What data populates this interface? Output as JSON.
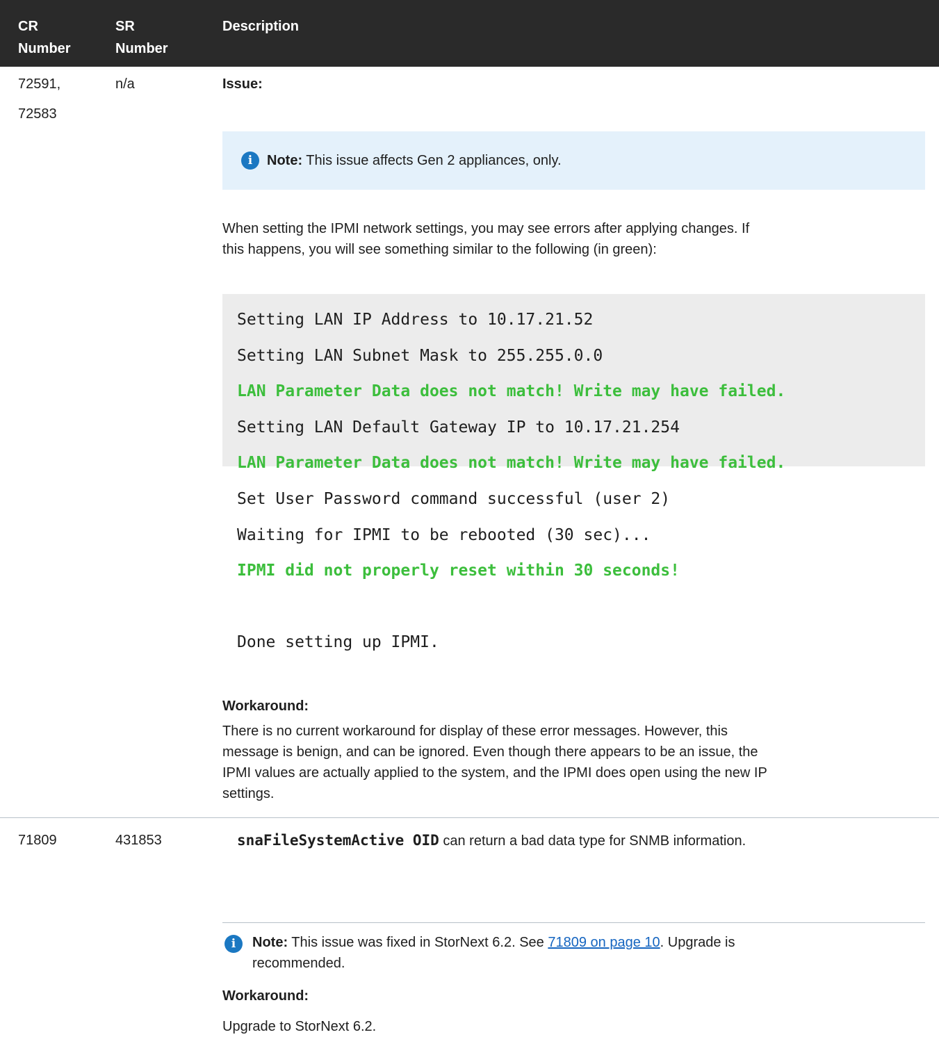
{
  "header": {
    "cr_line1": "CR",
    "cr_line2": "Number",
    "sr_line1": "SR",
    "sr_line2": "Number",
    "description": "Description"
  },
  "row1": {
    "cr_line1": "72591,",
    "cr_line2": "72583",
    "sr": "n/a",
    "issue_label": "Issue:",
    "note_label": "Note:",
    "note_text": " This issue affects Gen 2 appliances, only.",
    "paragraph_line1": "When setting the IPMI network settings, you may see errors after applying changes. If",
    "paragraph_line2": "this happens, you will see something similar to the following (in green):",
    "code_lines": [
      "Setting LAN IP Address to 10.17.21.52",
      "Setting LAN Subnet Mask to 255.255.0.0",
      "LAN Parameter Data does not match! Write may have failed.",
      "Setting LAN Default Gateway IP to 10.17.21.254",
      "LAN Parameter Data does not match! Write may have failed.",
      "Set User Password command successful (user 2)",
      "Waiting for IPMI to be rebooted (30 sec)...",
      "IPMI did not properly reset within 30 seconds!",
      "Done setting up IPMI."
    ],
    "workaround_label": "Workaround:",
    "workaround_lines": [
      "There is no current workaround for display of these error messages. However, this",
      "message is benign, and can be ignored. Even though there appears to be an issue, the",
      "IPMI values are actually applied to the system, and the IPMI does open using the new IP",
      "settings."
    ]
  },
  "row2": {
    "cr": "71809",
    "sr": "431853",
    "oid_code": "snaFileSystemActive OID",
    "oid_text": " can return a bad data type for SNMB information.",
    "note_label": "Note:",
    "note_text_1": " This issue was fixed in StorNext 6.2. See ",
    "note_link": "71809 on page 10",
    "note_text_2": ". Upgrade is",
    "note_text_3": "recommended.",
    "workaround_label": "Workaround:",
    "workaround_text": "Upgrade to StorNext 6.2."
  },
  "colors": {
    "header_bg": "#2a2a2a",
    "note_bg": "#e4f1fb",
    "code_bg": "#ececec",
    "error_green": "#3cbe3c",
    "info_blue": "#1b78c2",
    "link_blue": "#1565c0"
  },
  "icons": [
    "info-icon"
  ]
}
